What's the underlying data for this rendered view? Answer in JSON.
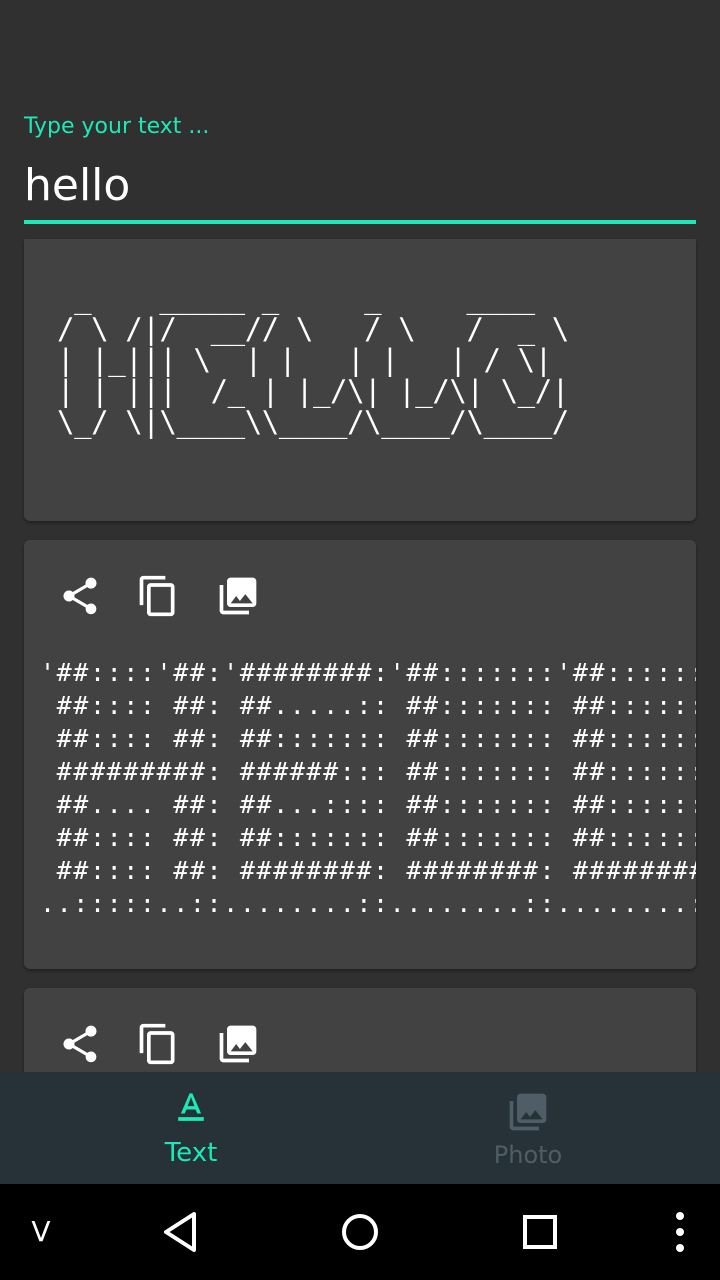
{
  "input": {
    "label": "Type your text ...",
    "value": "hello"
  },
  "outputs": [
    {
      "art": "  _    _____ _     _     ____  \n / \\ /|/  __// \\   / \\   /  _ \\\n | |_||| \\  | |   | |   | / \\|\n | | |||  /_ | |_/\\| |_/\\| \\_/|\n \\_/ \\|\\____\\\\____/\\____/\\____/"
    },
    {
      "art": "'##::::'##:'########:'##:::::::'##:::::::\n ##:::: ##: ##.....:: ##::::::: ##:::::::\n ##:::: ##: ##::::::: ##::::::: ##:::::::\n #########: ######::: ##::::::: ##:::::::\n ##.... ##: ##...:::: ##::::::: ##:::::::\n ##:::: ##: ##::::::: ##::::::: ##:::::::\n ##:::: ##: ########: ########: ########:\n..:::::..::........::........::........::"
    }
  ],
  "actions": {
    "share_icon": "share-icon",
    "copy_icon": "copy-icon",
    "image_icon": "photo-library-icon"
  },
  "bottom_nav": {
    "tabs": [
      {
        "label": "Text",
        "icon": "text-format-icon",
        "active": true
      },
      {
        "label": "Photo",
        "icon": "photo-library-icon",
        "active": false
      }
    ]
  },
  "system_nav": {
    "left_label": "V"
  },
  "colors": {
    "accent": "#1de9b6",
    "background": "#303030",
    "card": "#424242",
    "bottom_nav": "#263238",
    "inactive_tab": "#4e5d66"
  }
}
